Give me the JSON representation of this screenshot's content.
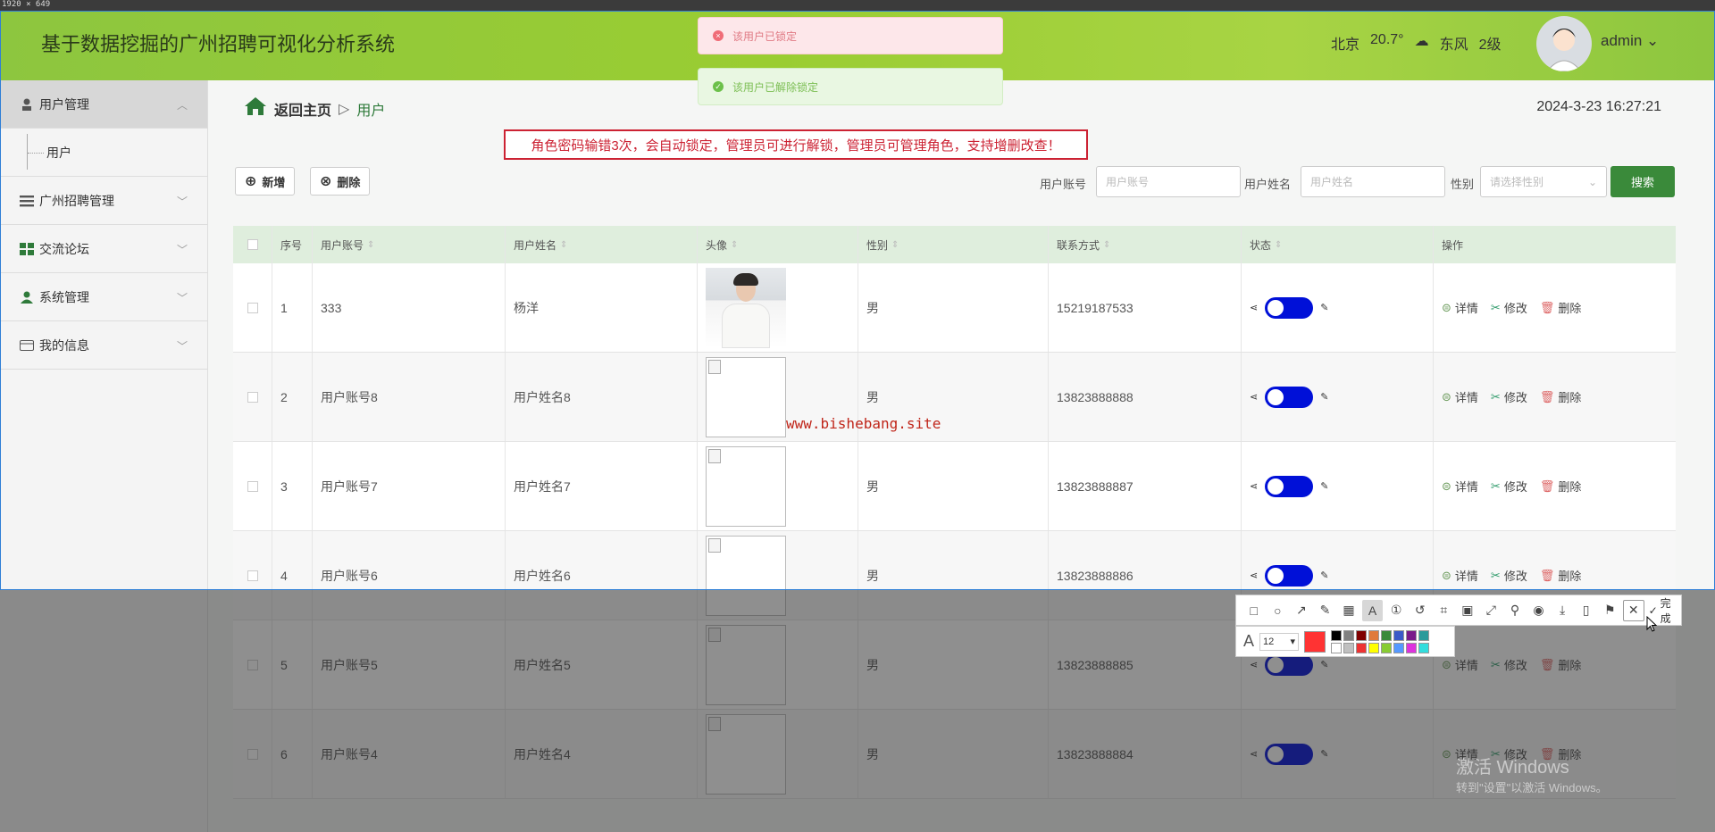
{
  "app": {
    "screen_size_label": "1920 × 649",
    "title": "基于数据挖掘的广州招聘可视化分析系统",
    "weather": {
      "city": "北京",
      "temp": "20.7°",
      "wind": "东风",
      "level": "2级"
    },
    "user": "admin",
    "toasts": {
      "error": "该用户已锁定",
      "success": "该用户已解除锁定"
    }
  },
  "sidebar": {
    "items": [
      {
        "label": "用户管理",
        "icon": "user-icon"
      },
      {
        "label": "用户",
        "icon": ""
      },
      {
        "label": "广州招聘管理",
        "icon": "list-icon"
      },
      {
        "label": "交流论坛",
        "icon": "grid-icon"
      },
      {
        "label": "系统管理",
        "icon": "person-icon"
      },
      {
        "label": "我的信息",
        "icon": "card-icon"
      }
    ]
  },
  "breadcrumb": {
    "home": "返回主页",
    "current": "用户"
  },
  "datetime": "2024-3-23 16:27:21",
  "notice": "角色密码输错3次，会自动锁定，管理员可进行解锁，管理员可管理角色，支持增删改查！",
  "toolbar": {
    "add": "新增",
    "delete": "删除"
  },
  "search": {
    "account_label": "用户账号",
    "account_placeholder": "用户账号",
    "name_label": "用户姓名",
    "name_placeholder": "用户姓名",
    "gender_label": "性别",
    "gender_placeholder": "请选择性别",
    "button": "搜索"
  },
  "table": {
    "headers": [
      "序号",
      "用户账号",
      "用户姓名",
      "头像",
      "性别",
      "联系方式",
      "状态",
      "操作"
    ],
    "actions": {
      "detail": "详情",
      "edit": "修改",
      "delete": "删除"
    },
    "rows": [
      {
        "no": "1",
        "account": "333",
        "name": "杨洋",
        "gender": "男",
        "phone": "15219187533",
        "avatar": "photo"
      },
      {
        "no": "2",
        "account": "用户账号8",
        "name": "用户姓名8",
        "gender": "男",
        "phone": "13823888888",
        "avatar": "broken"
      },
      {
        "no": "3",
        "account": "用户账号7",
        "name": "用户姓名7",
        "gender": "男",
        "phone": "13823888887",
        "avatar": "broken"
      },
      {
        "no": "4",
        "account": "用户账号6",
        "name": "用户姓名6",
        "gender": "男",
        "phone": "13823888886",
        "avatar": "broken"
      },
      {
        "no": "5",
        "account": "用户账号5",
        "name": "用户姓名5",
        "gender": "男",
        "phone": "13823888885",
        "avatar": "broken"
      },
      {
        "no": "6",
        "account": "用户账号4",
        "name": "用户姓名4",
        "gender": "男",
        "phone": "13823888884",
        "avatar": "broken"
      }
    ]
  },
  "watermark": "www.bishebang.site",
  "screenshot_tool": {
    "done": "完成",
    "font_size": "12"
  },
  "windows_activation": {
    "line1": "激活 Windows",
    "line2": "转到\"设置\"以激活 Windows。"
  }
}
